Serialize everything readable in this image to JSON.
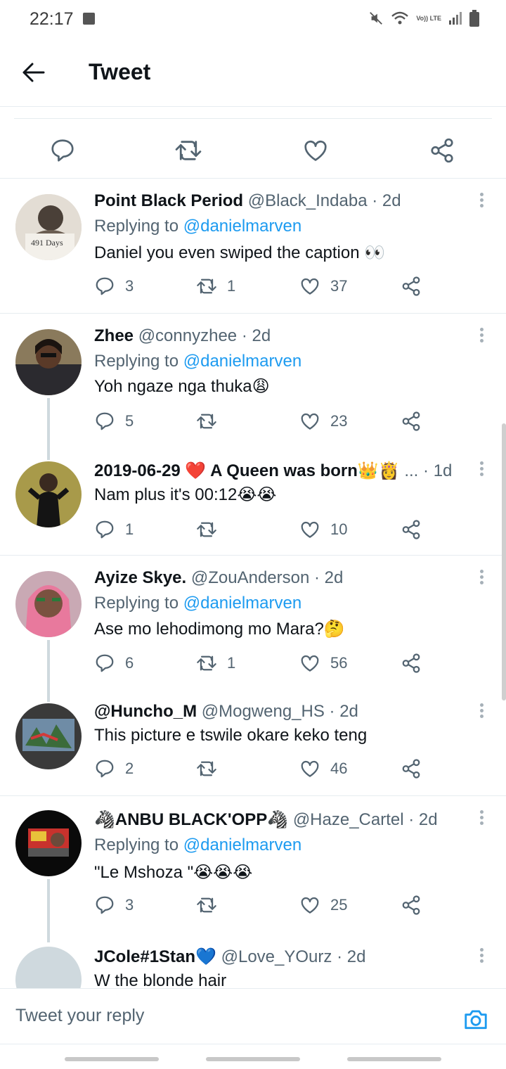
{
  "status": {
    "time": "22:17",
    "network": "Vo)) LTE"
  },
  "header": {
    "title": "Tweet"
  },
  "reply_box": {
    "placeholder": "Tweet your reply"
  },
  "replies": [
    {
      "name": "Point Black Period",
      "handle": "@Black_Indaba",
      "time": "· 2d",
      "replying_to": "Replying to ",
      "mention": "@danielmarven",
      "text": "Daniel you even swiped the caption 👀",
      "replies": "3",
      "retweets": "1",
      "likes": "37"
    },
    {
      "name": "Zhee",
      "handle": "@connyzhee",
      "time": "· 2d",
      "replying_to": "Replying to ",
      "mention": "@danielmarven",
      "text": "Yoh ngaze nga thuka😩",
      "replies": "5",
      "retweets": "",
      "likes": "23"
    },
    {
      "name": "2019-06-29 ❤️ A Queen was born👑👸",
      "handle": "...",
      "time": "· 1d",
      "text": "Nam plus it's 00:12😭😭",
      "replies": "1",
      "retweets": "",
      "likes": "10"
    },
    {
      "name": "Ayize Skye.",
      "handle": "@ZouAnderson",
      "time": "· 2d",
      "replying_to": "Replying to ",
      "mention": "@danielmarven",
      "text": "Ase mo lehodimong mo Mara?🤔",
      "replies": "6",
      "retweets": "1",
      "likes": "56"
    },
    {
      "name": "@Huncho_M",
      "handle": "@Mogweng_HS",
      "time": "· 2d",
      "text": "This picture e tswile okare keko teng",
      "replies": "2",
      "retweets": "",
      "likes": "46"
    },
    {
      "name": "🦓ANBU BLACK'OPP🦓",
      "handle": "@Haze_Cartel",
      "time": "· 2d",
      "replying_to": "Replying to ",
      "mention": "@danielmarven",
      "text": "\"Le Mshoza \"😭😭😭",
      "replies": "3",
      "retweets": "",
      "likes": "25"
    },
    {
      "name": "JCole#1Stan💙",
      "handle": "@Love_YOurz",
      "time": "· 2d",
      "text": "W the blonde hair"
    }
  ],
  "avatar_texts": {
    "r0": "491 Days"
  },
  "colors": {
    "link": "#1d9bf0",
    "muted": "#536471",
    "like_red": "#e0245e"
  }
}
